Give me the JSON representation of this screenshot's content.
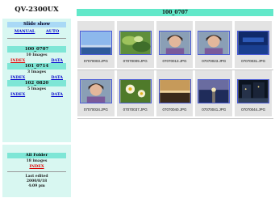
{
  "sidebar": {
    "title": "QV-2300UX",
    "slideshow_label": "Slide show",
    "manual_label": "MANUAL",
    "auto_label": "AUTO",
    "folders": [
      {
        "name": "100_0707",
        "count": "10 Images",
        "index": "INDEX",
        "data": "DATA"
      },
      {
        "name": "101_0714",
        "count": "3 Images",
        "index": "INDEX",
        "data": "DATA"
      },
      {
        "name": "102_0820",
        "count": "5 Images",
        "index": "INDEX",
        "data": "DATA"
      }
    ],
    "all_folder": "All Folder",
    "all_count": "18 images",
    "all_index": "INDEX",
    "last_edited_label": "Last edited",
    "last_edited_date": "2000/8/18",
    "last_edited_time": "4:09 pm"
  },
  "main": {
    "folder_title": "100_0707",
    "images": [
      {
        "file": "07070003.JPG",
        "icon": "camera-icon",
        "scene": "blue-sky"
      },
      {
        "file": "07070009.JPG",
        "icon": "camera-icon",
        "scene": "green-plant"
      },
      {
        "file": "07070013.JPG",
        "icon": "portrait-icon",
        "scene": "portrait"
      },
      {
        "file": "07070023.JPG",
        "icon": "portrait-icon",
        "scene": "portrait"
      },
      {
        "file": "07070031.JPG",
        "icon": "camera-icon",
        "scene": "blue-dark"
      },
      {
        "file": "07070034.JPG",
        "icon": "camera-icon",
        "scene": "portrait"
      },
      {
        "file": "07070037.JPG",
        "icon": "camera-icon",
        "scene": "flower"
      },
      {
        "file": "07070040.JPG",
        "icon": "landscape-icon",
        "scene": "sunset"
      },
      {
        "file": "07070041.JPG",
        "icon": "camera-icon",
        "scene": "sunset-water"
      },
      {
        "file": "07070044.JPG",
        "icon": "night-icon",
        "scene": "night"
      }
    ]
  },
  "colors": {
    "sidebar_bg": "#d8f7f1",
    "banner": "#62e8c9",
    "slideshow_bar": "#a9d9f6",
    "thumb_border": "#4a5bd6",
    "link_red": "#dd0000",
    "link_blue": "#0000cc"
  }
}
